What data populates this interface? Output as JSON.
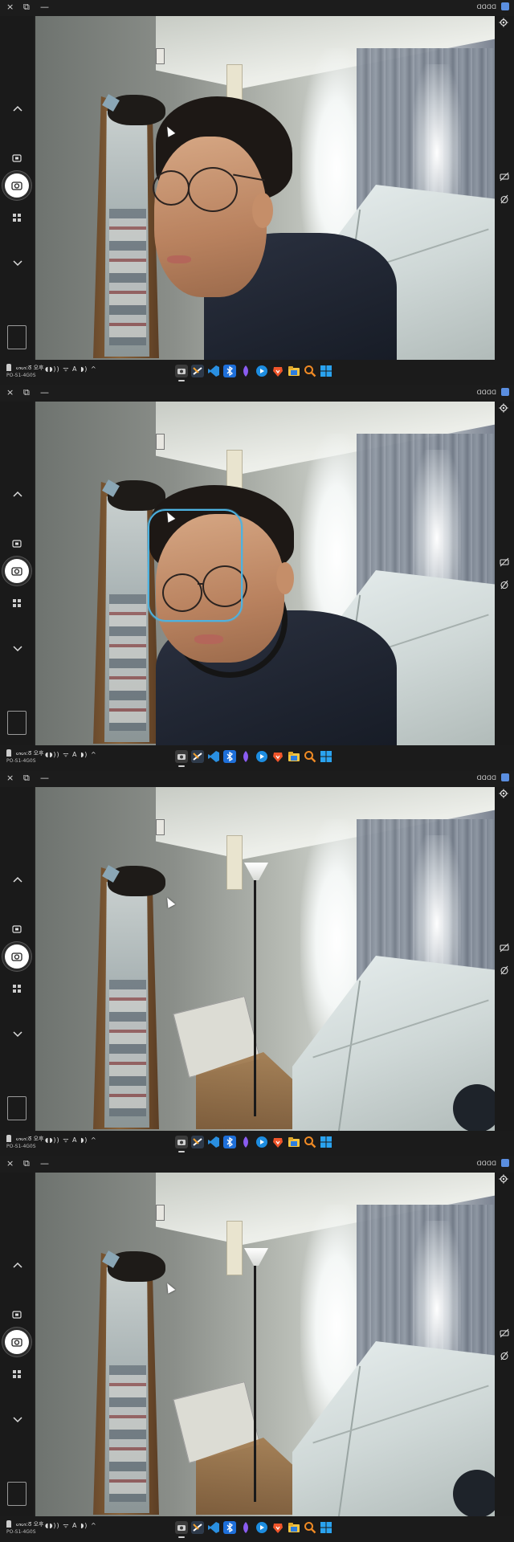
{
  "window": {
    "close_glyph": "×",
    "restore_glyph": "⧉",
    "minimize_glyph": "—",
    "status_text": "ᗡᗡᗡᗡ"
  },
  "taskbar": {
    "time": "ᔕᔕ:ᘔ 오후",
    "model": "PO-S1-4G0S",
    "tray_text": "◖◗)) ᯤ A ◗) ^"
  },
  "panels": [
    {
      "face_detected": false
    },
    {
      "face_detected": true
    },
    {
      "face_detected": false
    },
    {
      "face_detected": false
    }
  ],
  "colors": {
    "face_box": "#4db2e0",
    "accent_blue": "#1e88e5",
    "brave": "#f0552a"
  },
  "icons": {
    "left": [
      "chevron-up-icon",
      "camera-switch-icon",
      "shutter-camera-icon",
      "mode-grid-icon",
      "chevron-down-icon"
    ],
    "right": [
      "gear-icon",
      "hdr-off-icon",
      "timer-off-icon"
    ],
    "taskbar_apps": [
      "camera-app-icon",
      "snipping-tool-icon",
      "vscode-icon",
      "bluetooth-icon",
      "feather-app-icon",
      "media-player-icon",
      "brave-browser-icon",
      "file-explorer-icon",
      "search-icon",
      "start-windows-icon"
    ]
  }
}
